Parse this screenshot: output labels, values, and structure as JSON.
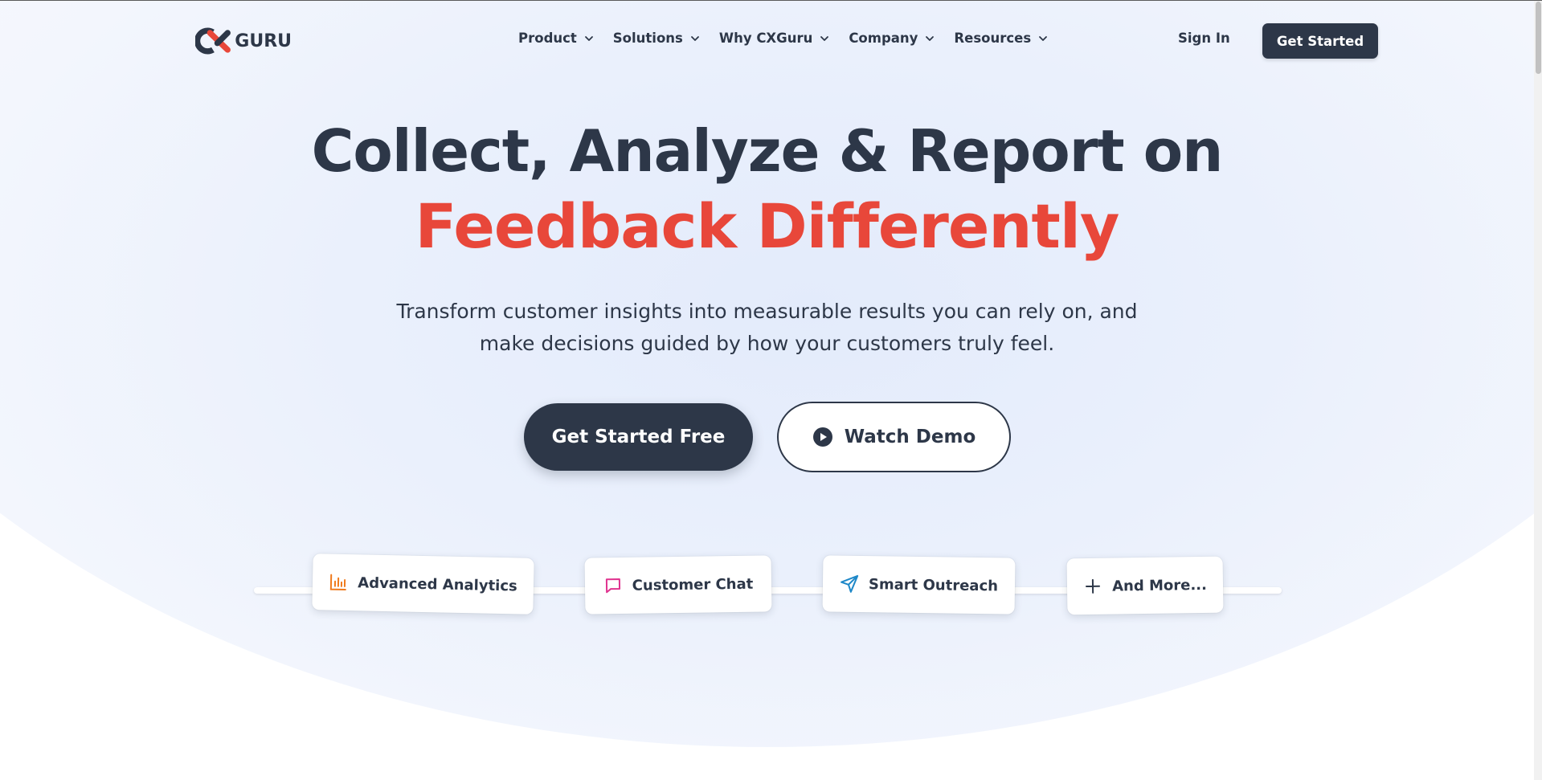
{
  "brand": {
    "logo_text": "GURU",
    "accent": "#e8473a",
    "dark": "#2d3748"
  },
  "nav": {
    "items": [
      {
        "label": "Product"
      },
      {
        "label": "Solutions"
      },
      {
        "label": "Why CXGuru"
      },
      {
        "label": "Company"
      },
      {
        "label": "Resources"
      }
    ],
    "signin_label": "Sign In",
    "cta_label": "Get Started"
  },
  "hero": {
    "title_line1": "Collect, Analyze & Report on",
    "title_line2": "Feedback Differently",
    "subtitle_line1": "Transform customer insights into measurable results you can rely on, and",
    "subtitle_line2": "make decisions guided by how your customers truly feel.",
    "primary_cta": "Get Started Free",
    "secondary_cta": "Watch Demo"
  },
  "features": [
    {
      "label": "Advanced Analytics",
      "icon": "bar-chart-icon",
      "color": "#f07a1c"
    },
    {
      "label": "Customer Chat",
      "icon": "chat-bubble-icon",
      "color": "#e0338f"
    },
    {
      "label": "Smart Outreach",
      "icon": "send-icon",
      "color": "#1e88c8"
    },
    {
      "label": "And More...",
      "icon": "plus-icon",
      "color": "#2d3748"
    }
  ]
}
